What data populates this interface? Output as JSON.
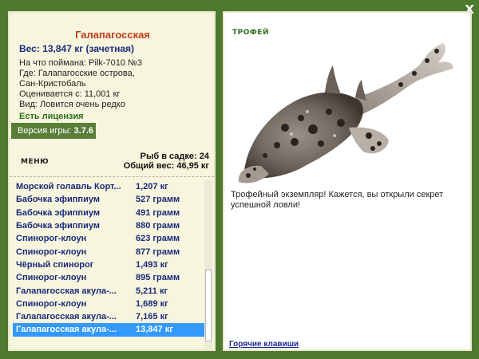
{
  "window": {
    "close_label": "X"
  },
  "fish": {
    "name": "Галапагосская",
    "weight_line": "Вес: 13,847 кг (зачетная)",
    "lines": [
      "На что поймана: Pilk-7010 №3",
      "Где: Галапагосские острова,",
      "Сан-Кристобаль",
      "Оценивается с: 11,001 кг",
      "Вид: Ловится очень редко"
    ]
  },
  "license": "Есть лицензия",
  "version": {
    "label": "Версия игры:",
    "value": "3.7.6"
  },
  "menu_label": "МЕНЮ",
  "stats": {
    "cage": "Рыб в садке: 24",
    "total": "Общий вес: 46,95 кг"
  },
  "catch_list": [
    {
      "name": "Морской голавль Корт...",
      "weight": "1,207 кг"
    },
    {
      "name": "Бабочка эфиппиум",
      "weight": "527 грамм"
    },
    {
      "name": "Бабочка эфиппиум",
      "weight": "491 грамм"
    },
    {
      "name": "Бабочка эфиппиум",
      "weight": "880 грамм"
    },
    {
      "name": "Спинорог-клоун",
      "weight": "623 грамм"
    },
    {
      "name": "Спинорог-клоун",
      "weight": "877 грамм"
    },
    {
      "name": "Чёрный спинорог",
      "weight": "1,493 кг"
    },
    {
      "name": "Спинорог-клоун",
      "weight": "895 грамм"
    },
    {
      "name": "Галапагосская акула-...",
      "weight": "5,211 кг"
    },
    {
      "name": "Спинорог-клоун",
      "weight": "1,689 кг"
    },
    {
      "name": "Галапагосская акула-...",
      "weight": "7,165 кг"
    },
    {
      "name": "Галапагосская акула-...",
      "weight": "13,847 кг"
    }
  ],
  "selected_index": 11,
  "trophy": {
    "label": "ТРОФЕЙ",
    "text": "Трофейный экземпляр! Кажется, вы открыли секрет успешной ловли!",
    "hotkeys": "Горячие клавиши"
  },
  "colors": {
    "frame": "#4d7a2e",
    "panel": "#f7f5dd",
    "selected": "#3399ff",
    "name": "#c03a1a",
    "list_text": "#1a2a7a"
  }
}
